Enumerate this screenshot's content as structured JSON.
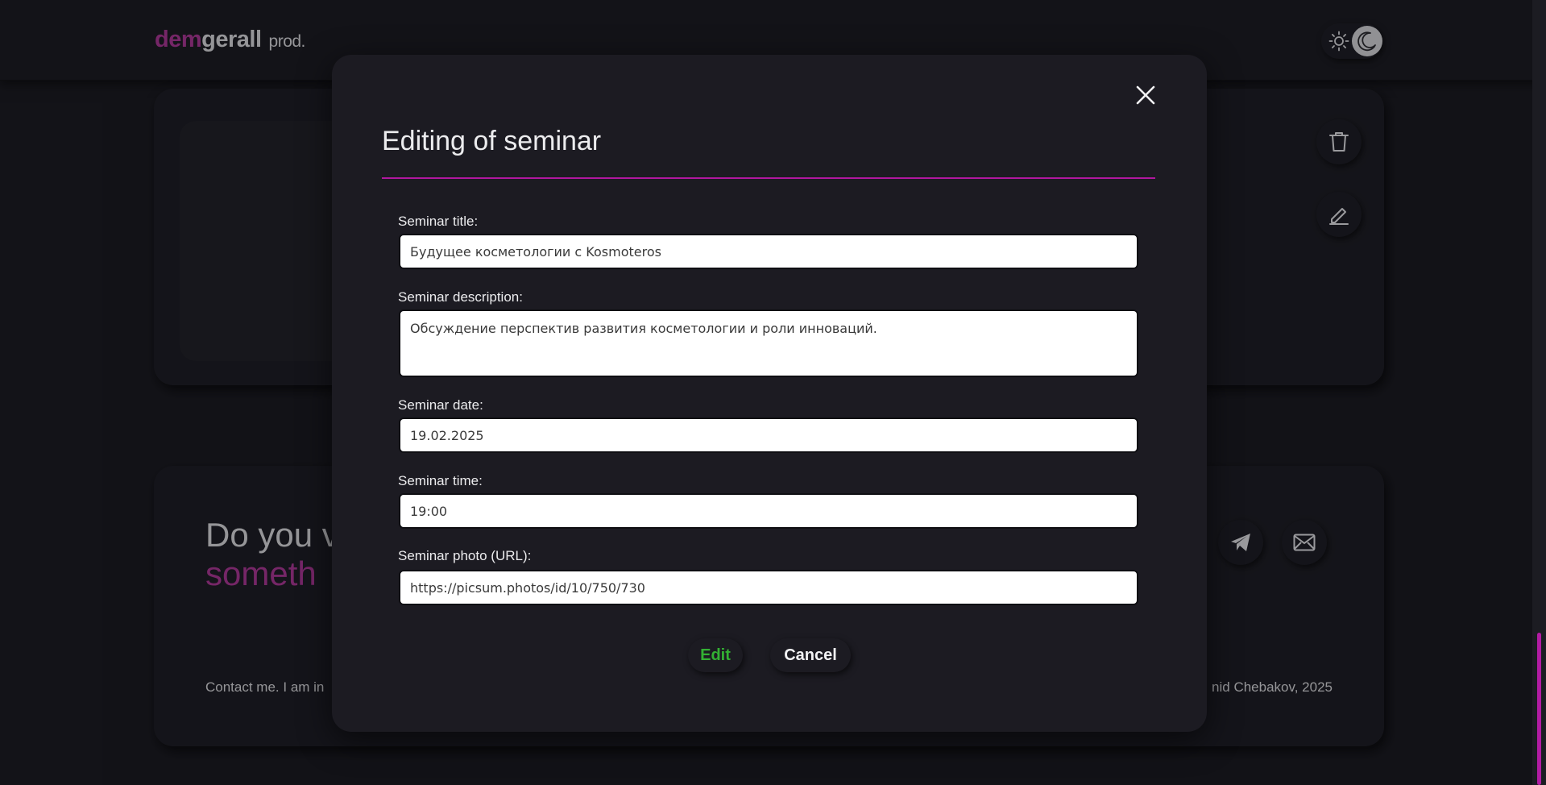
{
  "header": {
    "logo": {
      "part1": "dem",
      "part2": "gerall",
      "suffix": "prod."
    },
    "theme_toggle": {
      "light_icon": "sun-icon",
      "dark_icon": "moon-icon",
      "active": "dark"
    }
  },
  "seminar_card": {
    "actions": {
      "delete_icon": "trash-icon",
      "edit_icon": "pencil-icon"
    }
  },
  "contact_card": {
    "heading_line1": "Do you v",
    "heading_line2": "someth",
    "contact_text": "Contact me. I am in",
    "copyright": "nid Chebakov, 2025",
    "social": [
      "telegram-icon",
      "mail-icon"
    ]
  },
  "modal": {
    "title": "Editing of seminar",
    "close_icon": "close-icon",
    "fields": [
      {
        "label": "Seminar title:",
        "value": "Будущее косметологии с Kosmoteros"
      },
      {
        "label": "Seminar description:",
        "value": "Обсуждение перспектив развития косметологии и роли инноваций."
      },
      {
        "label": "Seminar date:",
        "value": "19.02.2025"
      },
      {
        "label": "Seminar time:",
        "value": "19:00"
      },
      {
        "label": "Seminar photo (URL):",
        "value": "https://picsum.photos/id/10/750/730"
      }
    ],
    "buttons": {
      "edit": "Edit",
      "cancel": "Cancel"
    }
  },
  "colors": {
    "accent": "#a3358f",
    "rule": "#b0179f",
    "edit_green": "#33b033",
    "background": "#1a1a21"
  }
}
